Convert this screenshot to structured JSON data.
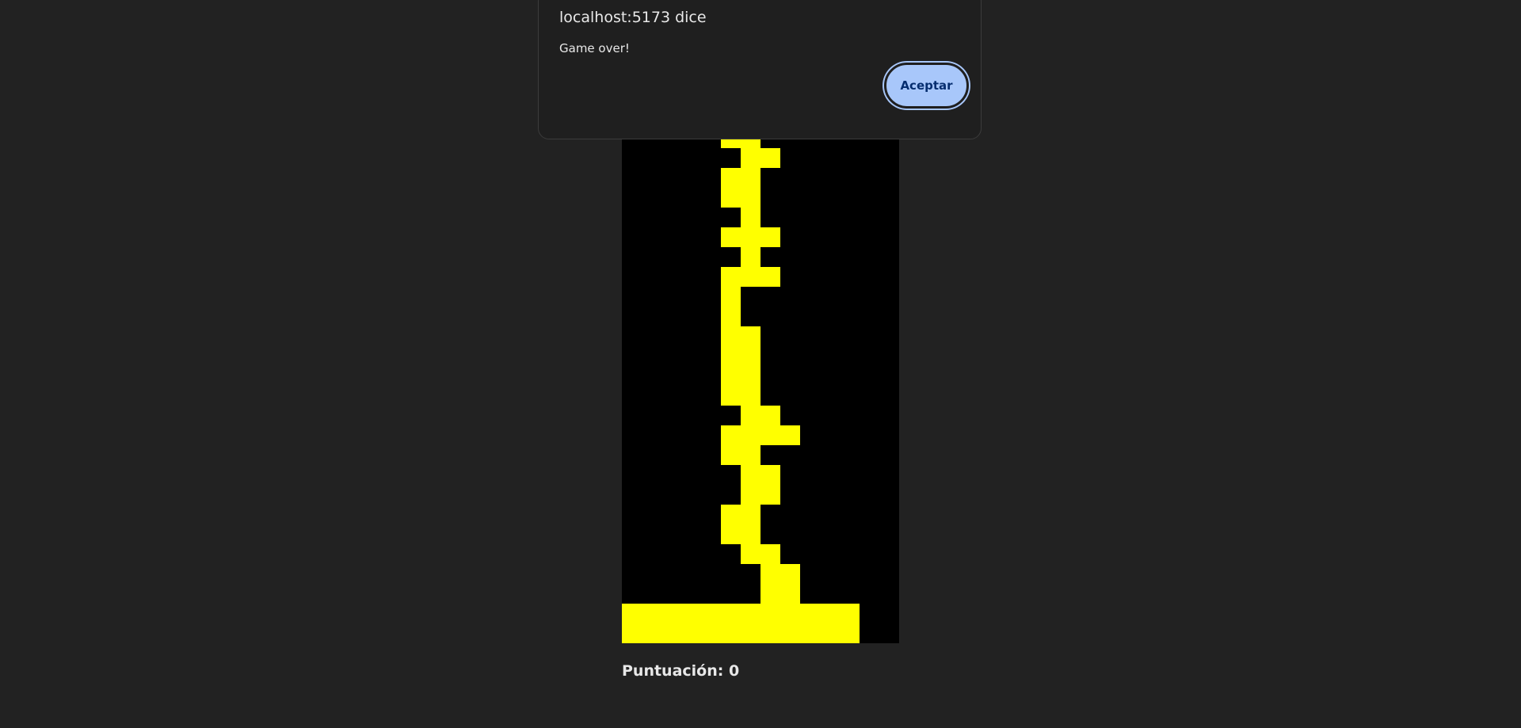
{
  "dialog": {
    "title": "localhost:5173 dice",
    "message": "Game over!",
    "accept_label": "Aceptar"
  },
  "game": {
    "score_label": "Puntuación: 0",
    "colors": {
      "board": "#000000",
      "block": "#ffff00",
      "page": "#222222",
      "button": "#a8c7fa"
    }
  }
}
